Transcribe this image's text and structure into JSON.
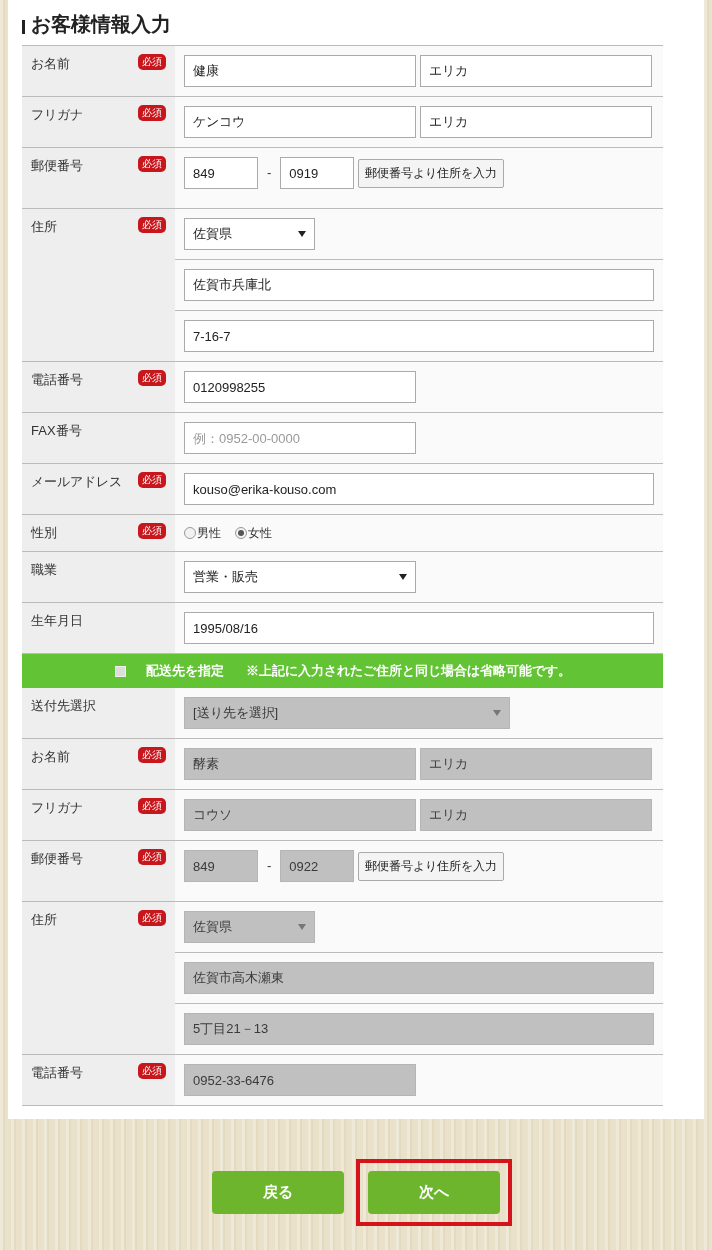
{
  "heading": "お客様情報入力",
  "customer_rows": [
    {
      "label": "お名前",
      "badge": "必須",
      "lines": [
        [
          {
            "kind": "input",
            "value": "健康",
            "disabled": false
          },
          {
            "kind": "input",
            "value": "エリカ",
            "disabled": false
          }
        ]
      ]
    },
    {
      "label": "フリガナ",
      "badge": "必須",
      "lines": [
        [
          {
            "kind": "input",
            "value": "ケンコウ",
            "disabled": false
          },
          {
            "kind": "input",
            "value": "エリカ",
            "disabled": false
          }
        ]
      ]
    },
    {
      "label": "郵便番号",
      "badge": "必須",
      "lines": [
        [
          {
            "kind": "input_short",
            "value": "849",
            "disabled": false
          },
          {
            "kind": "separator",
            "text": "-"
          },
          {
            "kind": "input_short",
            "value": "0919",
            "disabled": false
          },
          {
            "kind": "button",
            "text": "郵便番号より住所を入力"
          }
        ]
      ]
    },
    {
      "label": "住所",
      "badge": "必須",
      "lines": [
        [
          {
            "kind": "select_short",
            "value": "佐賀県",
            "disabled": false
          }
        ],
        [
          {
            "kind": "input_wide",
            "value": "佐賀市兵庫北",
            "disabled": false
          }
        ],
        [
          {
            "kind": "input_wide",
            "value": "7-16-7",
            "disabled": false
          }
        ]
      ]
    },
    {
      "label": "電話番号",
      "badge": "必須",
      "lines": [
        [
          {
            "kind": "input",
            "value": "0120998255",
            "disabled": false
          }
        ]
      ]
    },
    {
      "label": "FAX番号",
      "lines": [
        [
          {
            "kind": "input",
            "placeholder": "例：0952-00-0000",
            "disabled": false
          }
        ]
      ]
    },
    {
      "label": "メールアドレス",
      "badge": "必須",
      "lines": [
        [
          {
            "kind": "input_wide",
            "value": "kouso@erika-kouso.com",
            "disabled": false
          }
        ]
      ]
    },
    {
      "label": "性別",
      "badge": "必須",
      "lines": [
        [
          {
            "kind": "radio",
            "options": [
              {
                "label": "男性",
                "selected": false
              },
              {
                "label": "女性",
                "selected": true
              }
            ]
          }
        ]
      ]
    },
    {
      "label": "職業",
      "lines": [
        [
          {
            "kind": "select",
            "value": "営業・販売",
            "disabled": false
          }
        ]
      ]
    },
    {
      "label": "生年月日",
      "lines": [
        [
          {
            "kind": "input_wide",
            "value": "1995/08/16",
            "disabled": false
          }
        ]
      ]
    }
  ],
  "shipping_bar": {
    "checked": false,
    "label": "配送先を指定",
    "note": "※上記に入力されたご住所と同じ場合は省略可能です。"
  },
  "shipping_rows": [
    {
      "label": "送付先選択",
      "lines": [
        [
          {
            "kind": "select_long",
            "value": "[送り先を選択]",
            "disabled": true
          }
        ]
      ]
    },
    {
      "label": "お名前",
      "badge": "必須",
      "lines": [
        [
          {
            "kind": "input",
            "value": "酵素",
            "disabled": true
          },
          {
            "kind": "input",
            "value": "エリカ",
            "disabled": true
          }
        ]
      ]
    },
    {
      "label": "フリガナ",
      "badge": "必須",
      "lines": [
        [
          {
            "kind": "input",
            "value": "コウソ",
            "disabled": true
          },
          {
            "kind": "input",
            "value": "エリカ",
            "disabled": true
          }
        ]
      ]
    },
    {
      "label": "郵便番号",
      "badge": "必須",
      "lines": [
        [
          {
            "kind": "input_short",
            "value": "849",
            "disabled": true
          },
          {
            "kind": "separator",
            "text": "-"
          },
          {
            "kind": "input_short",
            "value": "0922",
            "disabled": true
          },
          {
            "kind": "button",
            "text": "郵便番号より住所を入力"
          }
        ]
      ]
    },
    {
      "label": "住所",
      "badge": "必須",
      "lines": [
        [
          {
            "kind": "select_short",
            "value": "佐賀県",
            "disabled": true
          }
        ],
        [
          {
            "kind": "input_wide",
            "value": "佐賀市高木瀬東",
            "disabled": true
          }
        ],
        [
          {
            "kind": "input_wide",
            "value": "5丁目21－13",
            "disabled": true
          }
        ]
      ]
    },
    {
      "label": "電話番号",
      "badge": "必須",
      "lines": [
        [
          {
            "kind": "input",
            "value": "0952-33-6476",
            "disabled": true
          }
        ]
      ]
    }
  ],
  "buttons": [
    {
      "label": "戻る",
      "highlighted": false
    },
    {
      "label": "次へ",
      "highlighted": true
    }
  ]
}
